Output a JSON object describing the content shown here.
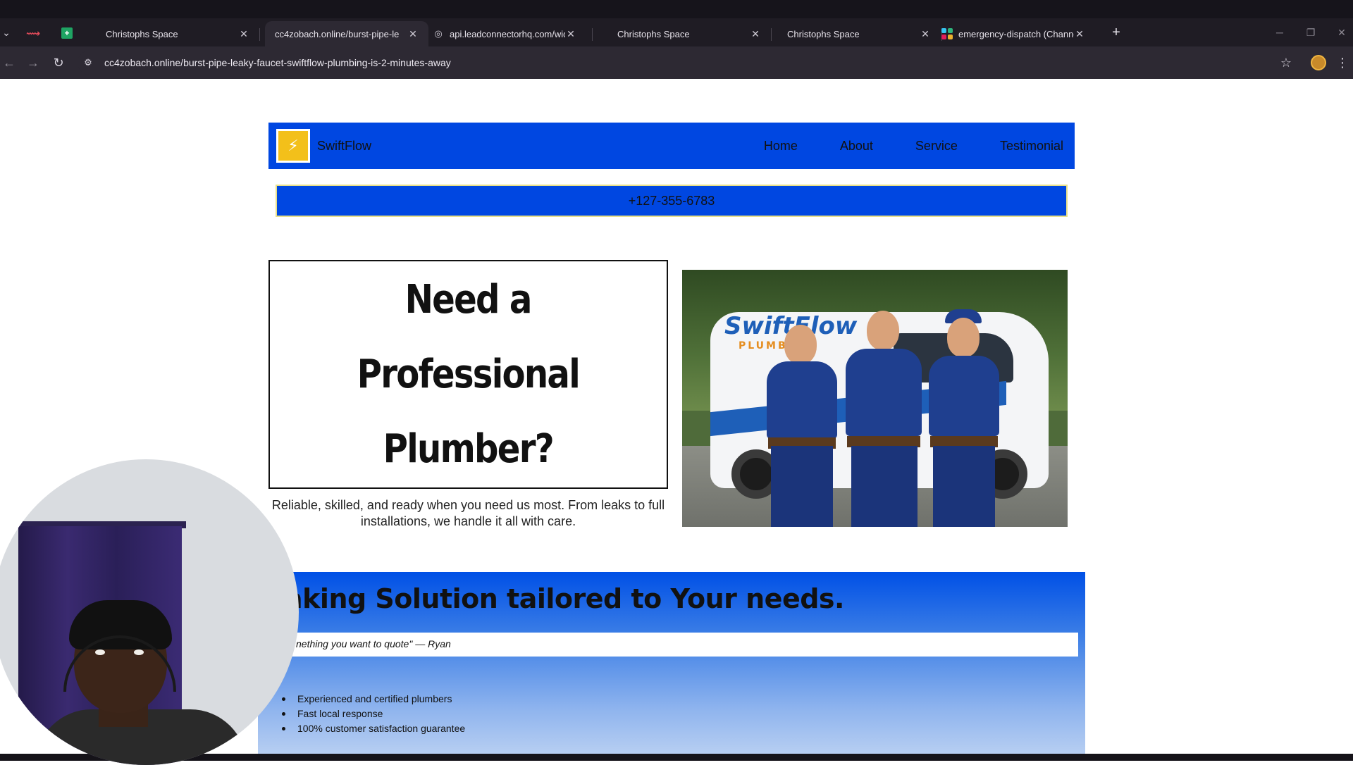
{
  "browser": {
    "tabs": [
      {
        "title": "Christophs Space",
        "favicon": "none",
        "active": false
      },
      {
        "title": "cc4zobach.online/burst-pipe-le",
        "favicon": "none",
        "active": true
      },
      {
        "title": "api.leadconnectorhq.com/widg",
        "favicon": "globe-icon",
        "active": false
      },
      {
        "title": "Christophs Space",
        "favicon": "none",
        "active": false
      },
      {
        "title": "Christophs Space",
        "favicon": "none",
        "active": false
      },
      {
        "title": "emergency-dispatch (Channel)",
        "favicon": "slack-icon",
        "active": false
      }
    ],
    "url": "cc4zobach.online/burst-pipe-leaky-faucet-swiftflow-plumbing-is-2-minutes-away",
    "glyphs": {
      "tab_menu": "⌄",
      "close": "✕",
      "new_tab": "+",
      "back": "←",
      "forward": "→",
      "reload": "↻",
      "site_info": "⚙",
      "star": "☆",
      "kebab": "⋮",
      "minimize": "─",
      "restore": "❐",
      "window_close": "✕",
      "globe": "◎"
    }
  },
  "site": {
    "brand": "SwiftFlow",
    "logo_glyph": "⚡",
    "nav": [
      "Home",
      "About",
      "Service",
      "Testimonial"
    ],
    "phone": "+127-355-6783",
    "hero": {
      "title_lines": [
        "Need a",
        "Professional",
        "Plumber?"
      ],
      "subtitle": "Reliable, skilled, and ready when you need us most. From leaks to full installations, we handle it all with care.",
      "photo_brand": "SwiftFlow",
      "photo_brand_sub": "PLUMBING"
    },
    "section": {
      "title": "aking Solution tailored to Your needs.",
      "quote": "nething you want to quote\" — Ryan",
      "features": [
        "Experienced and certified plumbers",
        "Fast local response",
        "100% customer satisfaction guarantee"
      ]
    }
  },
  "colors": {
    "brand_blue": "#0047e1",
    "logo_yellow": "#f3c01a",
    "chrome_dark": "#1f1c24"
  }
}
